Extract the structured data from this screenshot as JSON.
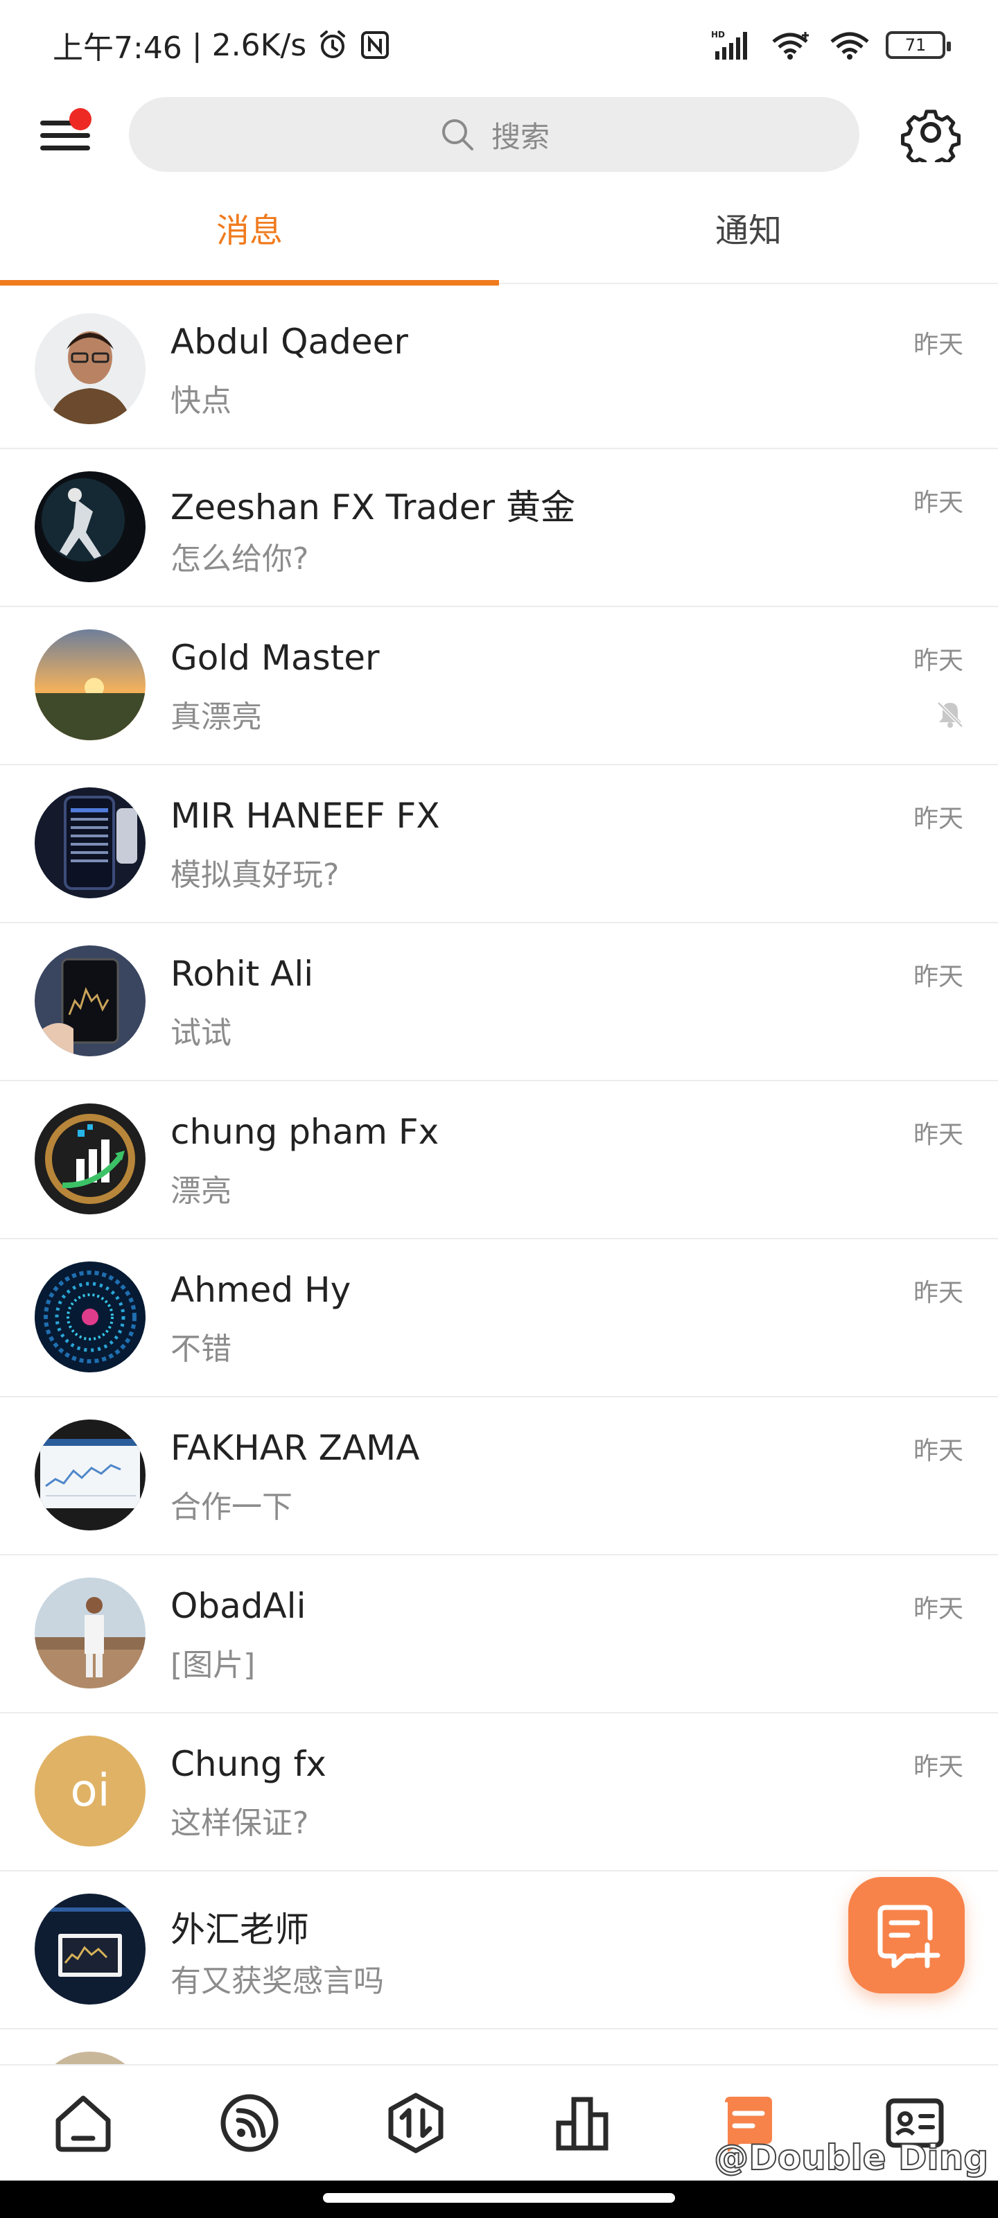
{
  "status_bar": {
    "time": "上午7:46",
    "separator": "|",
    "net_speed": "2.6K/s",
    "alarm_icon": "alarm-icon",
    "nfc_icon": "nfc-icon",
    "battery": "71"
  },
  "header": {
    "search_placeholder": "搜索"
  },
  "tabs": [
    {
      "label": "消息",
      "active": true
    },
    {
      "label": "通知",
      "active": false
    }
  ],
  "conversations": [
    {
      "name": "Abdul Qadeer",
      "message": "快点",
      "time": "昨天"
    },
    {
      "name": "Zeeshan FX Trader 黄金",
      "message": "怎么给你?",
      "time": "昨天"
    },
    {
      "name": "Gold Master",
      "message": "真漂亮",
      "time": "昨天",
      "muted": true
    },
    {
      "name": "MIR HANEEF FX",
      "message": "模拟真好玩?",
      "time": "昨天"
    },
    {
      "name": "Rohit Ali",
      "message": "试试",
      "time": "昨天"
    },
    {
      "name": "chung pham Fx",
      "message": "漂亮",
      "time": "昨天"
    },
    {
      "name": "Ahmed Hy",
      "message": "不错",
      "time": "昨天"
    },
    {
      "name": "FAKHAR ZAMA",
      "message": "合作一下",
      "time": "昨天"
    },
    {
      "name": "ObadAli",
      "message": "[图片]",
      "time": "昨天"
    },
    {
      "name": "Chung fx",
      "message": "这样保证?",
      "time": "昨天",
      "avatar_text": "oi"
    },
    {
      "name": "外汇老师",
      "message": "有又获奖感言吗",
      "time": ""
    }
  ],
  "bottom_nav": [
    {
      "icon": "home-icon",
      "active": false
    },
    {
      "icon": "feed-icon",
      "active": false
    },
    {
      "icon": "trade-icon",
      "active": false
    },
    {
      "icon": "chart-icon",
      "active": false
    },
    {
      "icon": "message-icon",
      "active": true
    },
    {
      "icon": "profile-card-icon",
      "active": false
    }
  ],
  "watermark": "@Double Ding",
  "colors": {
    "accent": "#f07b1e",
    "fab": "#f7834a",
    "badge": "#ee2a24",
    "muted_text": "#8c8c8c"
  }
}
